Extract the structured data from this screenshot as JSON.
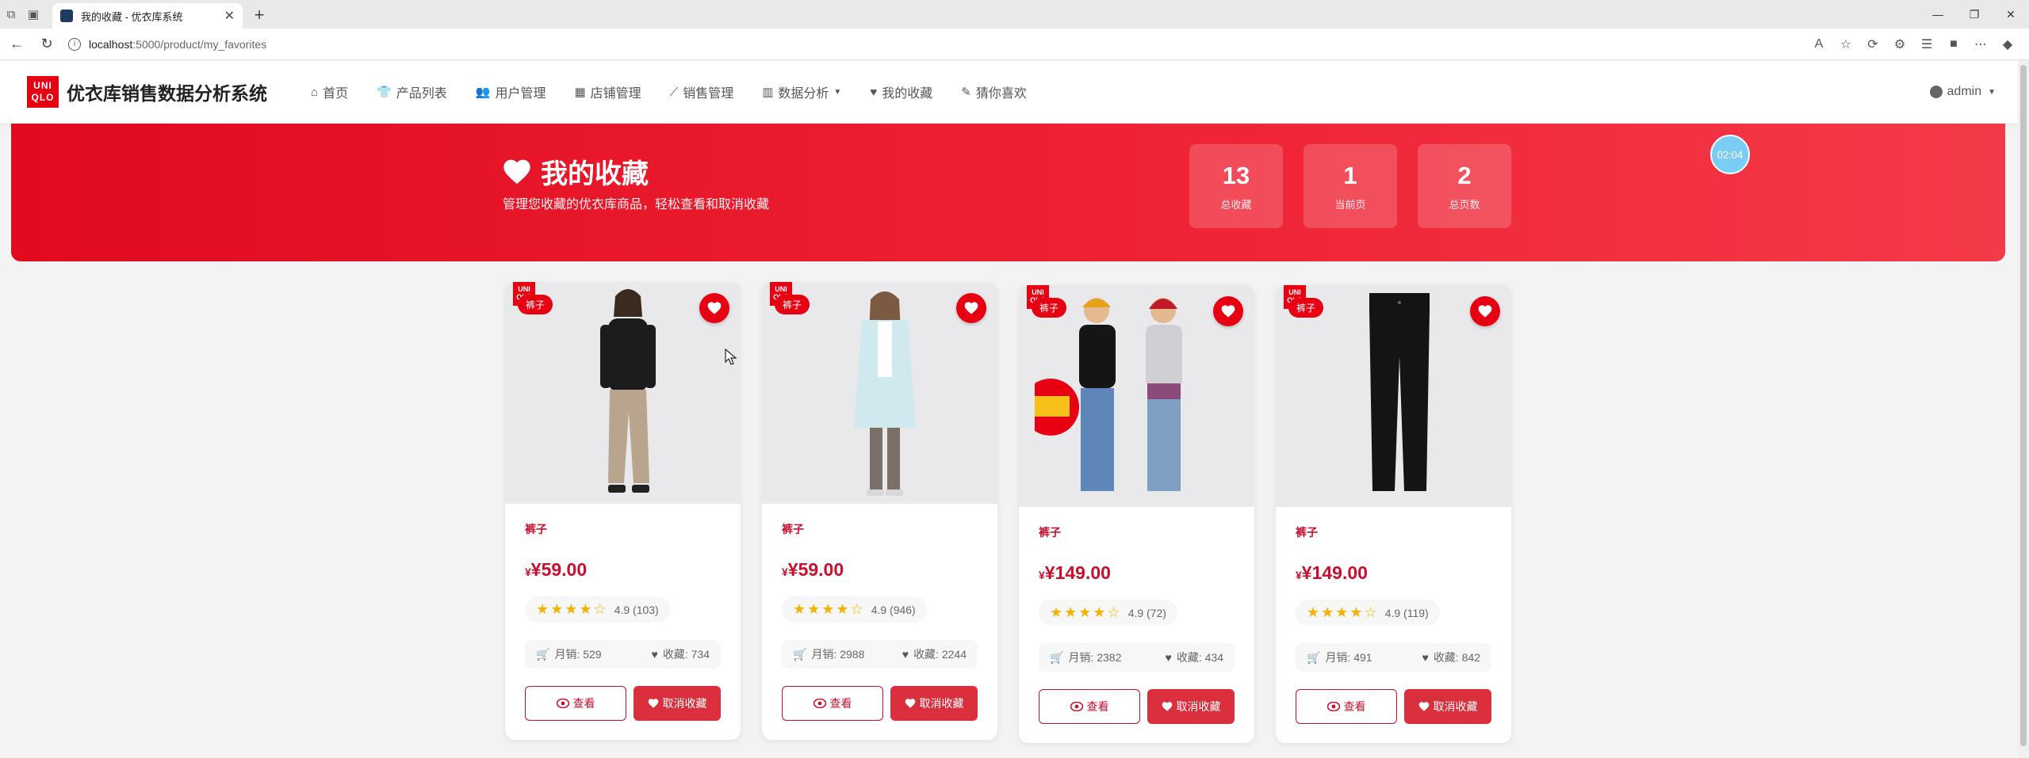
{
  "browser": {
    "tab_title": "我的收藏 - 优衣库系统",
    "url_host": "localhost",
    "url_rest": ":5000/product/my_favorites"
  },
  "navbar": {
    "logo_line1": "UNI",
    "logo_line2": "QLO",
    "brand": "优衣库销售数据分析系统",
    "items": [
      {
        "label": "首页",
        "icon": "home-icon"
      },
      {
        "label": "产品列表",
        "icon": "tshirt-icon"
      },
      {
        "label": "用户管理",
        "icon": "users-icon"
      },
      {
        "label": "店铺管理",
        "icon": "store-icon"
      },
      {
        "label": "销售管理",
        "icon": "chart-line-icon"
      },
      {
        "label": "数据分析",
        "icon": "chart-bar-icon"
      },
      {
        "label": "我的收藏",
        "icon": "heart-icon"
      },
      {
        "label": "猜你喜欢",
        "icon": "pencil-icon"
      }
    ],
    "user": "admin"
  },
  "hero": {
    "title": "我的收藏",
    "subtitle": "管理您收藏的优衣库商品，轻松查看和取消收藏",
    "stats": [
      {
        "value": "13",
        "label": "总收藏"
      },
      {
        "value": "1",
        "label": "当前页"
      },
      {
        "value": "2",
        "label": "总页数"
      }
    ],
    "timer": "02:04"
  },
  "cards": [
    {
      "tag": "裤子",
      "category": "裤子",
      "currency": "¥",
      "price": "¥59.00",
      "rating": "4.9 (103)",
      "stars": 4,
      "sales": "月销: 529",
      "favs": "收藏: 734",
      "view": "查看",
      "unfav": "取消收藏"
    },
    {
      "tag": "裤子",
      "category": "裤子",
      "currency": "¥",
      "price": "¥59.00",
      "rating": "4.9 (946)",
      "stars": 4,
      "sales": "月销: 2988",
      "favs": "收藏: 2244",
      "view": "查看",
      "unfav": "取消收藏"
    },
    {
      "tag": "裤子",
      "category": "裤子",
      "currency": "¥",
      "price": "¥149.00",
      "rating": "4.9 (72)",
      "stars": 4,
      "sales": "月销: 2382",
      "favs": "收藏: 434",
      "view": "查看",
      "unfav": "取消收藏"
    },
    {
      "tag": "裤子",
      "category": "裤子",
      "currency": "¥",
      "price": "¥149.00",
      "rating": "4.9 (119)",
      "stars": 4,
      "sales": "月销: 491",
      "favs": "收藏: 842",
      "view": "查看",
      "unfav": "取消收藏"
    }
  ],
  "colors": {
    "brand_red": "#e60012",
    "price_red": "#c8102e"
  }
}
